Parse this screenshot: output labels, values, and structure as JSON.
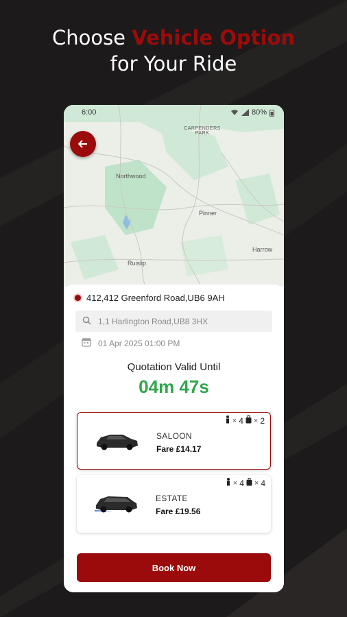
{
  "headline": {
    "line1_plain": "Choose ",
    "line1_accent": "Vehicle Option",
    "line2": "for Your Ride"
  },
  "status_bar": {
    "time": "6:00",
    "battery": "80%"
  },
  "map": {
    "labels": {
      "park": "CARPENDERS PARK",
      "northwood": "Northwood",
      "pinner": "Pinner",
      "harrow": "Harrow",
      "ruislip": "Ruislip"
    }
  },
  "trip": {
    "pickup": "412,412 Greenford Road,UB6 9AH",
    "dropoff": "1,1 Harlington Road,UB8 3HX",
    "datetime": "01 Apr 2025 01:00 PM"
  },
  "quotation": {
    "label": "Quotation Valid Until",
    "timer": "04m 47s"
  },
  "vehicles": [
    {
      "name": "SALOON",
      "fare": "Fare £14.17",
      "passengers": "4",
      "luggage": "2",
      "selected": true
    },
    {
      "name": "ESTATE",
      "fare": "Fare £19.56",
      "passengers": "4",
      "luggage": "4",
      "selected": false
    }
  ],
  "book_button": "Book Now",
  "colors": {
    "accent": "#9b0b0b",
    "timer": "#2fa64a",
    "background": "#1c1a1a"
  },
  "icons": [
    "back-arrow-icon",
    "search-icon",
    "calendar-icon",
    "person-icon",
    "luggage-icon",
    "wifi-icon",
    "signal-icon",
    "battery-icon"
  ]
}
